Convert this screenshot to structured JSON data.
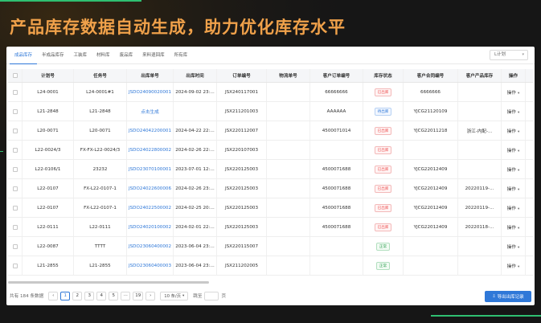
{
  "headline": "产品库存数据自动生成，助力优化库存水平",
  "colors": {
    "accent": "#2f78d8",
    "title": "#f0a14a",
    "deco": "#2fbf71"
  },
  "tabs": [
    "成品库存",
    "半成品库存",
    "工装库",
    "材料库",
    "废品库",
    "来料退回库",
    "所有库"
  ],
  "dropdown": {
    "value": "L计划",
    "icon": "chevron-down-icon"
  },
  "columns": [
    "计划号",
    "任务号",
    "出库单号",
    "出库时间",
    "订单编号",
    "物流单号",
    "客户订单编号",
    "库存状态",
    "客户合同编号",
    "客户产品库存",
    "操作"
  ],
  "rows": [
    {
      "plan": "L24-0001",
      "task": "L24-0001#1",
      "outno": "JSDO24090020001",
      "time": "2024-09-02 23:...",
      "order": "JSX240117001",
      "logi": "",
      "cust": "66666666",
      "status": "已出库",
      "stype": "red",
      "contract": "6666666",
      "prod": "",
      "op": "操作"
    },
    {
      "plan": "L21-2848",
      "task": "L21-2848",
      "outno": "点击生成",
      "time": "",
      "order": "JSX211201003",
      "logi": "",
      "cust": "AAAAAA",
      "status": "待出库",
      "stype": "blue",
      "contract": "YJCG21120109",
      "prod": "",
      "op": "操作"
    },
    {
      "plan": "L20-0071",
      "task": "L20-0071",
      "outno": "JSDO24042200001",
      "time": "2024-04-22 22:...",
      "order": "JSX220112007",
      "logi": "",
      "cust": "4500071014",
      "status": "已出库",
      "stype": "red",
      "contract": "YJCG22011218",
      "prod": "浙江-内配-...",
      "op": "操作"
    },
    {
      "plan": "L22-0024/3",
      "task": "FX-FX-L22-0024/3",
      "outno": "JSDO24022800002",
      "time": "2024-02-26 22:...",
      "order": "JSX220107003",
      "logi": "",
      "cust": "",
      "status": "已出库",
      "stype": "red",
      "contract": "",
      "prod": "",
      "op": "操作"
    },
    {
      "plan": "L22-0106/1",
      "task": "23232",
      "outno": "JSDO23070100001",
      "time": "2023-07-01 12:...",
      "order": "JSX220125003",
      "logi": "",
      "cust": "4500071688",
      "status": "已出库",
      "stype": "red",
      "contract": "YJCG22012409",
      "prod": "",
      "op": "操作"
    },
    {
      "plan": "L22-0107",
      "task": "FX-L22-0107-1",
      "outno": "JSDO24022600006",
      "time": "2024-02-26 23:...",
      "order": "JSX220125003",
      "logi": "",
      "cust": "4500071688",
      "status": "已出库",
      "stype": "red",
      "contract": "YJCG22012409",
      "prod": "20220119-...",
      "op": "操作"
    },
    {
      "plan": "L22-0107",
      "task": "FX-L22-0107-1",
      "outno": "JSDO24022500002",
      "time": "2024-02-25 20:...",
      "order": "JSX220125003",
      "logi": "",
      "cust": "4500071688",
      "status": "已出库",
      "stype": "red",
      "contract": "YJCG22012409",
      "prod": "20220119-...",
      "op": "操作"
    },
    {
      "plan": "L22-0111",
      "task": "L22-0111",
      "outno": "JSDO24020100002",
      "time": "2024-02-01 22:...",
      "order": "JSX220125003",
      "logi": "",
      "cust": "4500071688",
      "status": "已出库",
      "stype": "red",
      "contract": "YJCG22012409",
      "prod": "20220118-...",
      "op": "操作"
    },
    {
      "plan": "L22-0087",
      "task": "TTTT",
      "outno": "JSDO23060400002",
      "time": "2023-06-04 23:...",
      "order": "JSX220115007",
      "logi": "",
      "cust": "",
      "status": "正常",
      "stype": "green",
      "contract": "",
      "prod": "",
      "op": "操作"
    },
    {
      "plan": "L21-2855",
      "task": "L21-2855",
      "outno": "JSDO23060400003",
      "time": "2023-06-04 23:...",
      "order": "JSX211202005",
      "logi": "",
      "cust": "",
      "status": "正常",
      "stype": "green",
      "contract": "",
      "prod": "",
      "op": "操作"
    }
  ],
  "footer": {
    "total": "共有 184 条数据",
    "pages": [
      "1",
      "2",
      "3",
      "4",
      "5",
      "···",
      "19"
    ],
    "prev": "‹",
    "next": "›",
    "page_size": "10 条/页",
    "goto": "跳至",
    "page_unit": "页",
    "export": "导出出库记录"
  }
}
